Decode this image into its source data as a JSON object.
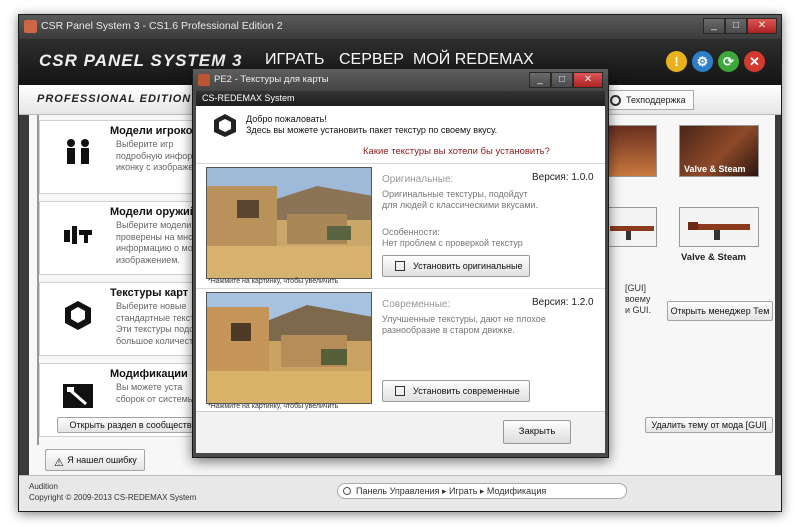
{
  "app": {
    "title": "CSR Panel System 3 - CS1.6 Professional Edition 2",
    "brand": "CSR PANEL SYSTEM 3",
    "edition": "PROFESSIONAL EDITION",
    "window_buttons": [
      "_",
      "□",
      "✕"
    ]
  },
  "nav": [
    "ИГРАТЬ",
    "СЕРВЕР",
    "МОЙ REDEMAX"
  ],
  "header_buttons": [
    {
      "glyph": "!",
      "color": "#e8b21c"
    },
    {
      "glyph": "⚙",
      "color": "#2d7fc9"
    },
    {
      "glyph": "⟳",
      "color": "#3ea83a"
    },
    {
      "glyph": "✕",
      "color": "#d23a2e"
    }
  ],
  "support_label": "Техподдержка",
  "cards": [
    {
      "title": "Модели игроков",
      "desc": "Выберите игр\nподробную информ\nиконку с изображени"
    },
    {
      "title": "Модели оружий",
      "desc": "Выберите модели\nпроверены на мног\nинформацию о мод\nизображением."
    },
    {
      "title": "Текстуры карт",
      "desc": "Выберите новые\nстандартные текст\nЭти текстуры подо\nбольшое количест"
    },
    {
      "title": "Модификации",
      "desc": "Вы можете уста\nсборок от системы"
    }
  ],
  "right_items": {
    "valve_label_1": "Valve & Steam",
    "valve_label_2": "Valve & Steam",
    "gui_text": "[GUI]\nвоему\nи GUI.",
    "theme_manager_button": "Открыть менеджер Тем"
  },
  "bottom_buttons": {
    "open_section": "Открыть раздел в сообществе",
    "delete_theme": "Удалить тему от мода [GUI]",
    "found_bug": "Я нашел ошибку"
  },
  "status": {
    "audition": "Audition",
    "copyright": "Copyright © 2009-2013 CS-REDEMAX System",
    "breadcrumb": "Панель Управления ▸ Играть ▸ Модификация"
  },
  "dialog": {
    "title": "PE2 - Текстуры для карты",
    "window_buttons": [
      "_",
      "□",
      "✕"
    ],
    "header": "CS-REDEMAX System",
    "welcome": "Добро пожаловать!\nЗдесь вы можете установить пакет текстур по своему вкусу.",
    "question": "Какие текстуры вы хотели бы установить?",
    "options": [
      {
        "title": "Оригинальные:",
        "version": "Версия: 1.0.0",
        "desc": "Оригинальные текстуры, подойдут\nдля людей с классическими вкусами.",
        "features": "Особенности:\nНет проблем с проверкой текстур",
        "button": "Установить оригинальные",
        "caption": "*Нажмите на картинку, чтобы увеличить"
      },
      {
        "title": "Современные:",
        "version": "Версия: 1.2.0",
        "desc": "Улучшенные текстуры, дают не плохое\nразнообразие в старом движке.",
        "features": "",
        "button": "Установить современные",
        "caption": "*Нажмите на картинку, чтобы увеличить"
      }
    ],
    "close_button": "Закрыть"
  }
}
